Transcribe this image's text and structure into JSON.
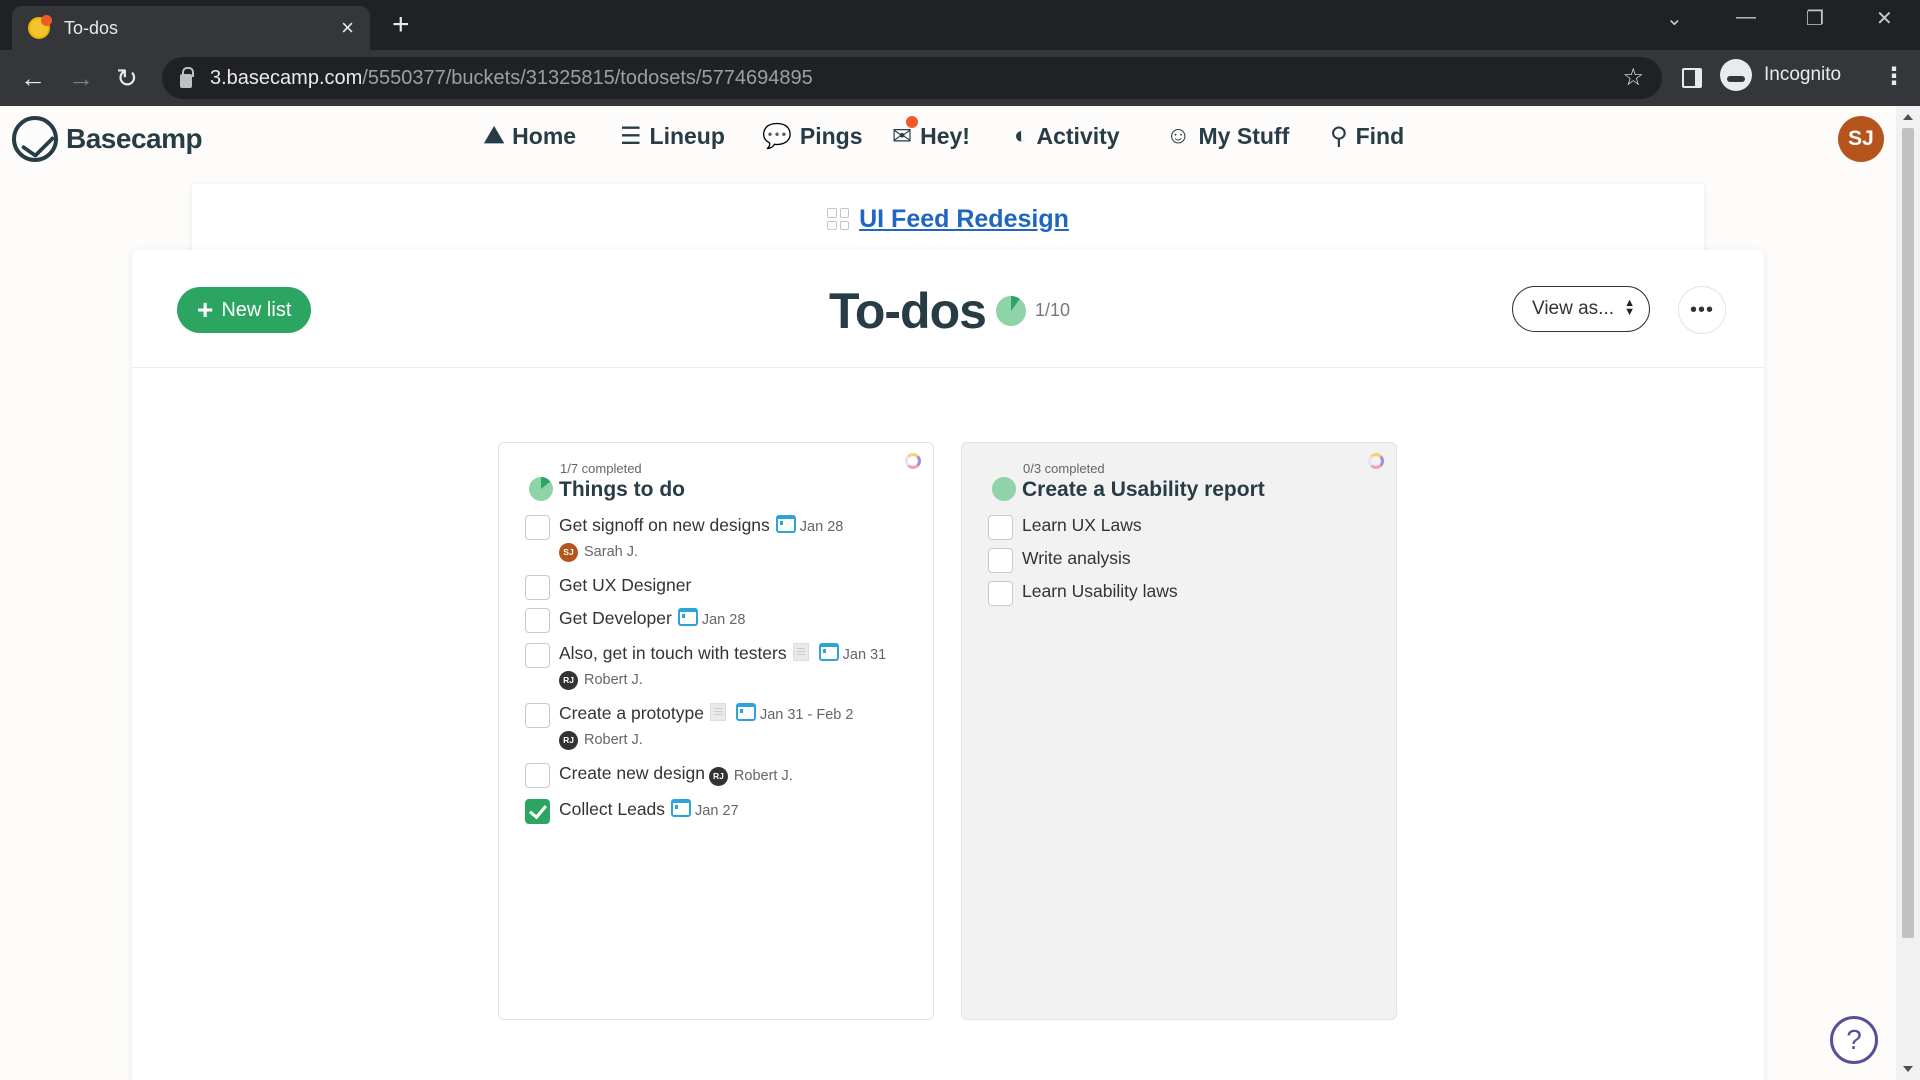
{
  "browser": {
    "tab_title": "To-dos",
    "tab_close": "×",
    "new_tab": "+",
    "url_host": "3.basecamp.com",
    "url_path": "/5550377/buckets/31325815/todosets/5774694895",
    "incognito_label": "Incognito",
    "icons": {
      "back": "←",
      "forward": "→",
      "reload": "↻",
      "star": "☆",
      "menu": "⋮",
      "tab_search": "⌄",
      "minimize": "—",
      "restore": "❐",
      "close": "✕"
    }
  },
  "app_nav": {
    "brand": "Basecamp",
    "items": [
      {
        "label": "Home",
        "icon": "⛰"
      },
      {
        "label": "Lineup",
        "icon": "☰"
      },
      {
        "label": "Pings",
        "icon": "💬"
      },
      {
        "label": "Hey!",
        "icon": "✉"
      },
      {
        "label": "Activity",
        "icon": "◐"
      },
      {
        "label": "My Stuff",
        "icon": "☺"
      },
      {
        "label": "Find",
        "icon": "⚲"
      }
    ],
    "avatar_initials": "SJ"
  },
  "project": {
    "name": "UI Feed Redesign"
  },
  "header": {
    "new_list_label": "New list",
    "new_list_icon": "+",
    "title": "To-dos",
    "progress_text": "1/10",
    "progress_fraction": 0.1,
    "view_as_label": "View as...",
    "more_label": "•••"
  },
  "lists": [
    {
      "completed_text": "1/7 completed",
      "progress_fraction": 0.142,
      "title": "Things to do",
      "items": [
        {
          "text": "Get signoff on new designs",
          "checked": false,
          "note": false,
          "date": "Jan 28",
          "assignee": {
            "initials": "SJ",
            "name": "Sarah J.",
            "color": "#b5541c"
          },
          "assignee_inline": false
        },
        {
          "text": "Get UX Designer",
          "checked": false,
          "note": false,
          "date": null,
          "assignee": null
        },
        {
          "text": "Get Developer",
          "checked": false,
          "note": false,
          "date": "Jan 28",
          "assignee": null
        },
        {
          "text": "Also, get in touch with testers",
          "checked": false,
          "note": true,
          "date": "Jan 31",
          "assignee": {
            "initials": "RJ",
            "name": "Robert J.",
            "color": "#333333"
          },
          "assignee_inline": false
        },
        {
          "text": "Create a prototype",
          "checked": false,
          "note": true,
          "date": "Jan 31 - Feb 2",
          "assignee": {
            "initials": "RJ",
            "name": "Robert J.",
            "color": "#333333"
          },
          "assignee_inline": false
        },
        {
          "text": "Create new design",
          "checked": false,
          "note": false,
          "date": null,
          "assignee": {
            "initials": "RJ",
            "name": "Robert J.",
            "color": "#333333"
          },
          "assignee_inline": true
        },
        {
          "text": "Collect Leads",
          "checked": true,
          "note": false,
          "date": "Jan 27",
          "assignee": null
        }
      ]
    },
    {
      "completed_text": "0/3 completed",
      "progress_fraction": 0,
      "title": "Create a Usability report",
      "items": [
        {
          "text": "Learn UX Laws",
          "checked": false,
          "note": false,
          "date": null,
          "assignee": null
        },
        {
          "text": "Write analysis",
          "checked": false,
          "note": false,
          "date": null,
          "assignee": null
        },
        {
          "text": "Learn Usability laws",
          "checked": false,
          "note": false,
          "date": null,
          "assignee": null
        }
      ]
    }
  ],
  "help_label": "?",
  "colors": {
    "brand_green": "#2da562",
    "pie_light": "#8fd3a8",
    "pie_dark": "#2da562",
    "link_blue": "#1e66c0",
    "calendar_blue": "#2ea3d7",
    "hey_dot": "#f05a28",
    "help_purple": "#5b4e96"
  }
}
